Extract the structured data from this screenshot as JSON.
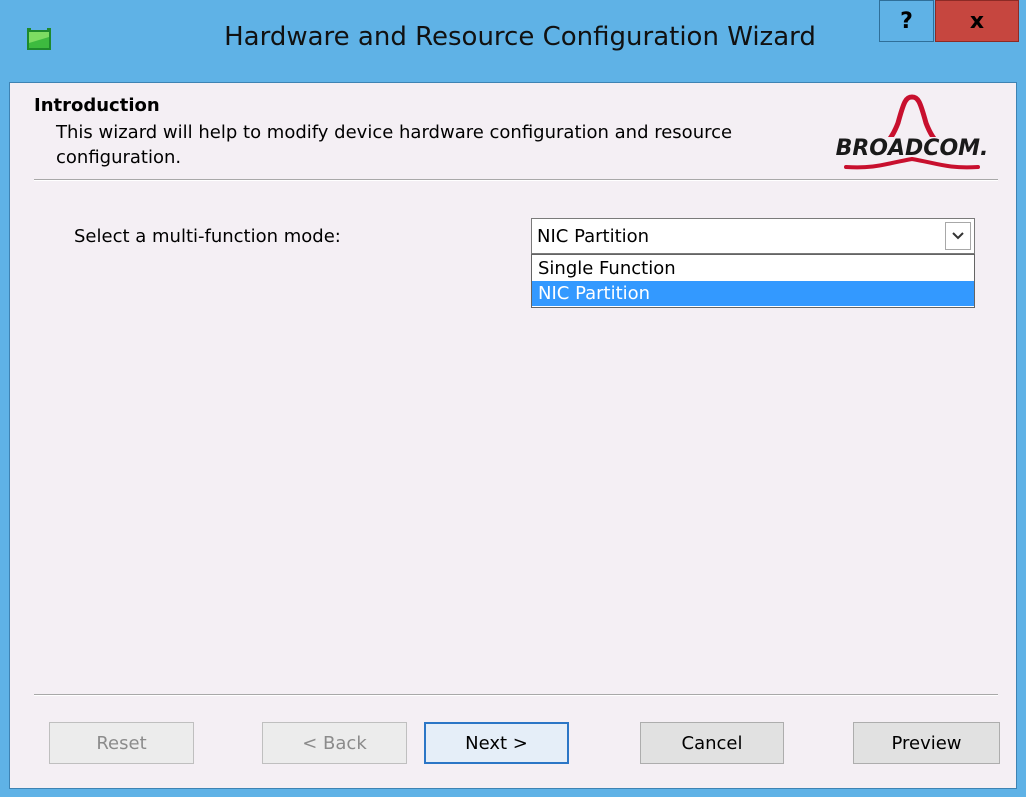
{
  "window": {
    "title": "Hardware and Resource Configuration Wizard",
    "help_label": "?",
    "close_label": "x"
  },
  "intro": {
    "title": "Introduction",
    "description": "This wizard will help to modify device hardware configuration and resource configuration."
  },
  "logo": {
    "text": "BROADCOM.",
    "color": "#c8102e"
  },
  "mode": {
    "label": "Select a multi-function mode:",
    "selected": "NIC Partition",
    "options": [
      "Single Function",
      "NIC Partition"
    ],
    "highlighted_option": "NIC Partition"
  },
  "buttons": {
    "reset": "Reset",
    "back": "< Back",
    "next": "Next >",
    "cancel": "Cancel",
    "preview": "Preview"
  },
  "colors": {
    "frame": "#5fb2e6",
    "close": "#c6463f",
    "highlight": "#3399ff"
  }
}
